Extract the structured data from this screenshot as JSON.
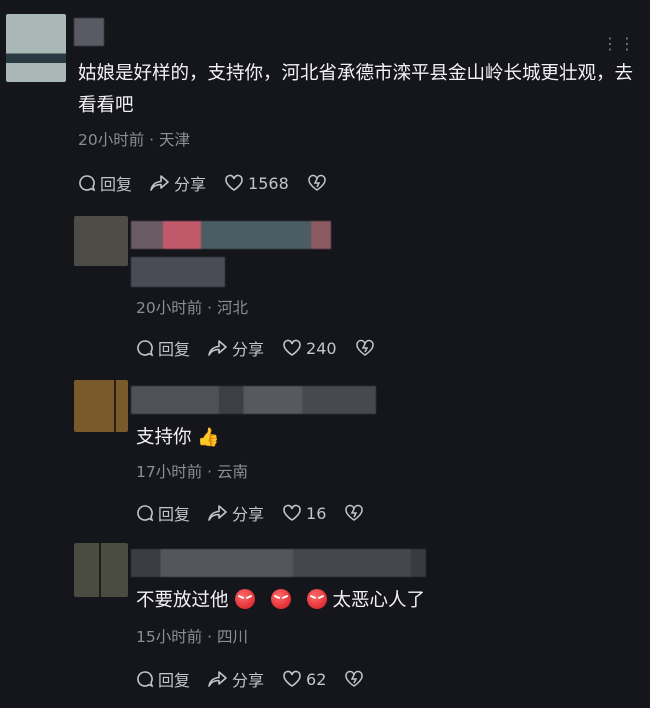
{
  "comments": [
    {
      "text": "姑娘是好样的，支持你，河北省承德市滦平县金山岭长城更壮观，去看看吧",
      "time": "20小时前",
      "location": "天津",
      "reply_label": "回复",
      "share_label": "分享",
      "likes": "1568"
    },
    {
      "text": "",
      "time": "20小时前",
      "location": "河北",
      "reply_label": "回复",
      "share_label": "分享",
      "likes": "240"
    },
    {
      "text": "支持你",
      "time": "17小时前",
      "location": "云南",
      "reply_label": "回复",
      "share_label": "分享",
      "likes": "16"
    },
    {
      "text_part1": "不要放过他",
      "text_part2": "太恶心人了",
      "time": "15小时前",
      "location": "四川",
      "reply_label": "回复",
      "share_label": "分享",
      "likes": "62"
    }
  ],
  "separator": "·",
  "icons": [
    "reply-icon",
    "share-icon",
    "heart-icon",
    "dislike-icon",
    "thumbs-up-emoji",
    "angry-emoji",
    "more-icon"
  ]
}
